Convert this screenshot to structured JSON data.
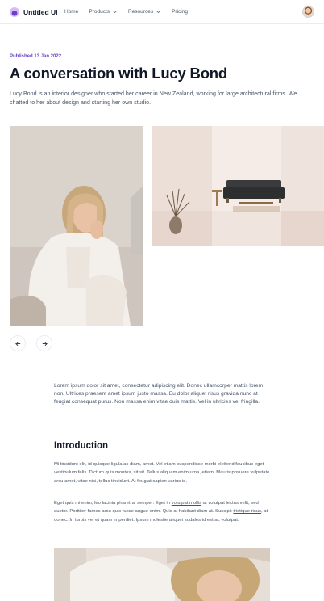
{
  "nav": {
    "brand": "Untitled UI",
    "links": [
      {
        "label": "Home"
      },
      {
        "label": "Products"
      },
      {
        "label": "Resources"
      },
      {
        "label": "Pricing"
      }
    ]
  },
  "article": {
    "published": "Published 13 Jan 2022",
    "title": "A conversation with Lucy Bond",
    "lede": "Lucy Bond is an interior designer who started her career in New Zealand, working for large architectural firms. We chatted to her about design and starting her own studio.",
    "intro": "Lorem ipsum dolor sit amet, consectetur adipiscing elit. Donec ullamcorper mattis lorem non. Ultrices praesent amet ipsum justo massa. Eu dolor aliquet risus gravida nunc at feugiat consequat purus. Non massa enim vitae duis mattis. Vel in ultricies vel fringilla.",
    "heading": "Introduction",
    "para1": "Mi tincidunt elit, id quisque ligula ac diam, amet. Vel etiam suspendisse morbi eleifend faucibus eget vestibulum felis. Dictum quis montes, sit sit. Tellus aliquam enim urna, etiam. Mauris posuere vulputate arcu amet, vitae nisi, tellus tincidunt. At feugiat sapien varius id.",
    "para2": {
      "part1": "Eget quis mi enim, leo lacinia pharetra, semper. Eget in ",
      "link1": "volutpat mollis",
      "part2": " at volutpat lectus velit, sed auctor. Porttitor fames arcu quis fusce augue enim. Quis at habitant diam at. Suscipit ",
      "link2": "tristique risus",
      "part3": ", at donec. In turpis vel et quam imperdiet. Ipsum molestie aliquet sodales id est ac volutpat."
    }
  },
  "icons": {
    "prev": "arrow-left-icon",
    "next": "arrow-right-icon",
    "chevron": "chevron-down-icon"
  },
  "colors": {
    "accent": "#6941c6",
    "text": "#101828",
    "muted": "#475467",
    "border": "#eaecf0"
  }
}
